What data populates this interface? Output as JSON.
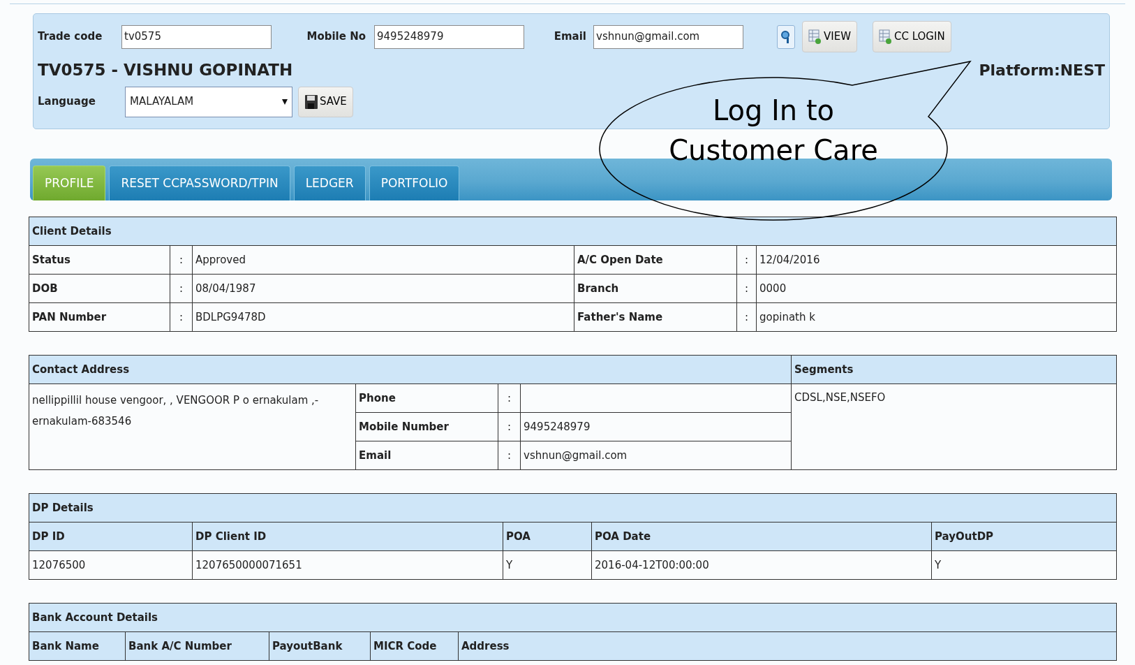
{
  "header": {
    "fields": [
      {
        "label": "Trade code",
        "value": "tv0575"
      },
      {
        "label": "Mobile No",
        "value": "9495248979"
      },
      {
        "label": "Email",
        "value": "vshnun@gmail.com"
      }
    ],
    "buttons": [
      {
        "label": "VIEW"
      },
      {
        "label": "CC LOGIN"
      }
    ],
    "customer_name": "TV0575 - VISHNU GOPINATH",
    "platform": "Platform:NEST",
    "language": {
      "label": "Language",
      "value": "MALAYALAM"
    },
    "save_label": "SAVE"
  },
  "tabs": [
    {
      "label": "PROFILE",
      "selected": true
    },
    {
      "label": "RESET CCPASSWORD/TPIN",
      "selected": false
    },
    {
      "label": "LEDGER",
      "selected": false
    },
    {
      "label": "PORTFOLIO",
      "selected": false
    }
  ],
  "client_details": {
    "title": "Client Details",
    "rows": [
      [
        {
          "label": "Status",
          "colon": ":",
          "value": "Approved"
        },
        {
          "label": "A/C Open Date",
          "colon": ":",
          "value": "12/04/2016"
        }
      ],
      [
        {
          "label": "DOB",
          "colon": ":",
          "value": "08/04/1987"
        },
        {
          "label": "Branch",
          "colon": ":",
          "value": "0000"
        }
      ],
      [
        {
          "label": "PAN Number",
          "colon": ":",
          "value": "BDLPG9478D"
        },
        {
          "label": "Father's Name",
          "colon": ":",
          "value": "gopinath k"
        }
      ]
    ]
  },
  "contact": {
    "title": "Contact Address",
    "segments_title": "Segments",
    "address": "nellippillil house vengoor, , VENGOOR P o ernakulam ,-ernakulam-683546",
    "fields": [
      {
        "label": "Phone",
        "colon": ":"
      },
      {
        "label": "Mobile Number",
        "colon": ":",
        "value": "9495248979"
      },
      {
        "label": "Email",
        "colon": ":",
        "value": "vshnun@gmail.com"
      }
    ],
    "segments": "CDSL,NSE,NSEFO"
  },
  "dp_details": {
    "title": "DP Details",
    "columns": [
      "DP ID",
      "DP Client ID",
      "POA",
      "POA Date",
      "PayOutDP"
    ],
    "rows": [
      [
        "12076500",
        "1207650000071651",
        "Y",
        "2016-04-12T00:00:00",
        "Y"
      ]
    ]
  },
  "bank_details": {
    "title": "Bank Account Details",
    "columns": [
      "Bank Name",
      "Bank A/C Number",
      "PayoutBank",
      "MICR Code",
      "Address"
    ]
  },
  "callout": {
    "lines": [
      "Log In to",
      "Customer Care"
    ]
  }
}
